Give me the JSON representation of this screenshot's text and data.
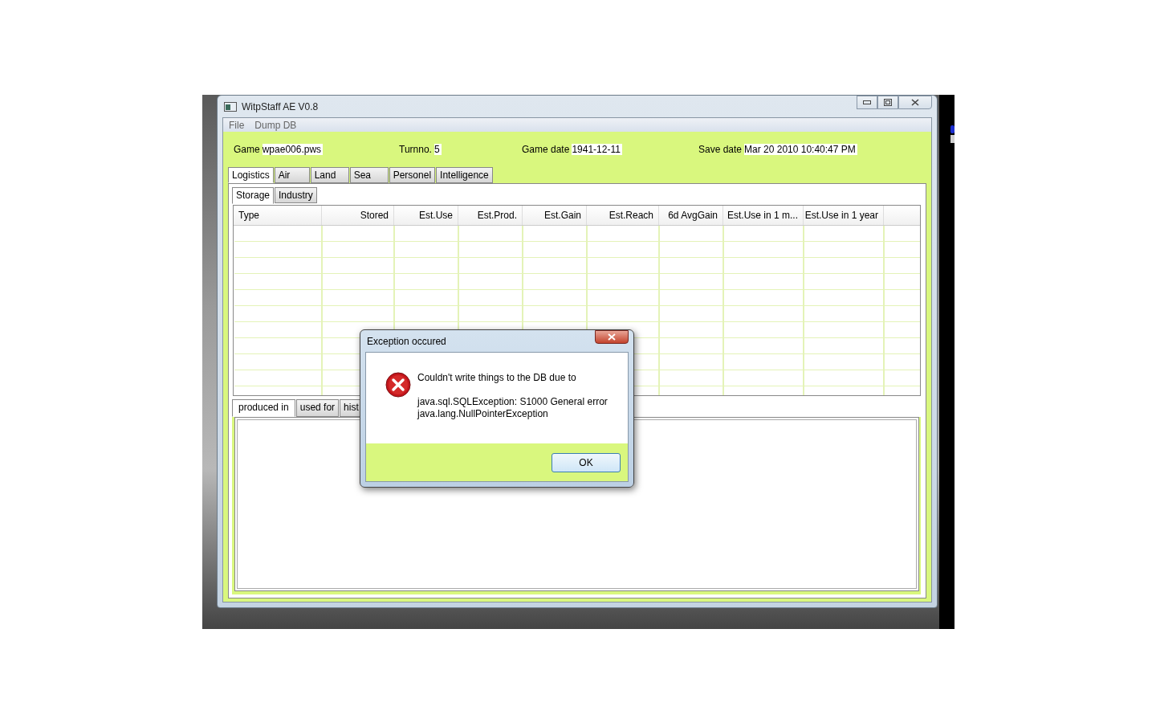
{
  "window": {
    "title": "WitpStaff AE V0.8"
  },
  "menu": [
    "File",
    "Dump DB"
  ],
  "info": [
    {
      "label": "Game",
      "value": "wpae006.pws"
    },
    {
      "label": "Turnno.",
      "value": "5"
    },
    {
      "label": "Game date",
      "value": "1941-12-11"
    },
    {
      "label": "Save date",
      "value": "Mar 20 2010  10:40:47 PM "
    }
  ],
  "tabs": [
    {
      "label": "Logistics",
      "selected": true
    },
    {
      "label": "Air",
      "selected": false
    },
    {
      "label": "Land",
      "selected": false
    },
    {
      "label": "Sea",
      "selected": false
    },
    {
      "label": "Personel",
      "selected": false
    },
    {
      "label": "Intelligence",
      "selected": false
    }
  ],
  "subtabs": [
    {
      "label": "Storage",
      "selected": true
    },
    {
      "label": "Industry",
      "selected": false
    }
  ],
  "table": {
    "columns": [
      "Type",
      "Stored",
      "Est.Use",
      "Est.Prod.",
      "Est.Gain",
      "Est.Reach",
      "6d AvgGain",
      "Est.Use in 1 m...",
      "Est.Use in 1 year"
    ]
  },
  "detail_tabs": [
    {
      "label": "produced in",
      "selected": true
    },
    {
      "label": "used for",
      "selected": false
    },
    {
      "label": "hist",
      "selected": false
    }
  ],
  "dialog": {
    "title": "Exception occured",
    "message": "Couldn't write things to the DB due to",
    "details": [
      "java.sql.SQLException: S1000 General error",
      "java.lang.NullPointerException"
    ],
    "button": "OK"
  }
}
